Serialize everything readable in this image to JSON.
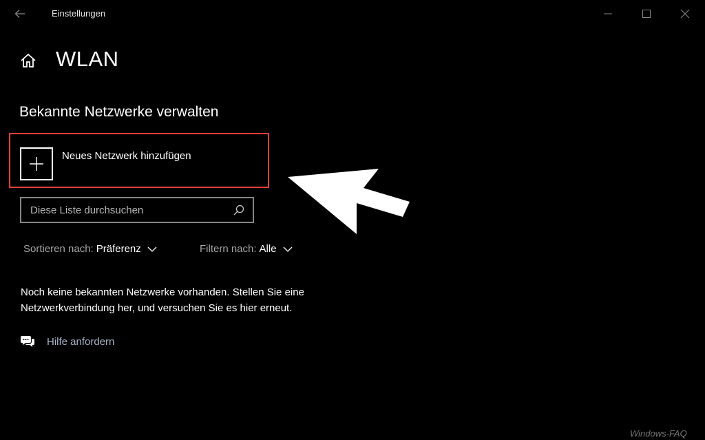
{
  "window": {
    "title": "Einstellungen"
  },
  "colors": {
    "background": "#000000",
    "highlight": "#e0423b",
    "link": "#a8b4c8",
    "muted": "#a6a6a6"
  },
  "icons": {
    "back": "arrow-left-icon",
    "home": "home-icon",
    "add": "plus-icon",
    "search": "search-icon",
    "chevron": "chevron-down-icon",
    "help": "chat-bubbles-icon",
    "annotation": "arrow-pointer-annotation"
  },
  "header": {
    "title": "WLAN"
  },
  "section": {
    "title": "Bekannte Netzwerke verwalten"
  },
  "add_network": {
    "label": "Neues Netzwerk hinzufügen"
  },
  "search": {
    "placeholder": "Diese Liste durchsuchen",
    "value": ""
  },
  "sort": {
    "label": "Sortieren nach:",
    "value": "Präferenz"
  },
  "filter": {
    "label": "Filtern nach:",
    "value": "Alle"
  },
  "empty": {
    "line1": "Noch keine bekannten Netzwerke vorhanden. Stellen Sie eine",
    "line2": "Netzwerkverbindung her, und versuchen Sie es hier erneut."
  },
  "help": {
    "label": "Hilfe anfordern"
  },
  "watermark": {
    "text": "Windows-FAQ"
  }
}
